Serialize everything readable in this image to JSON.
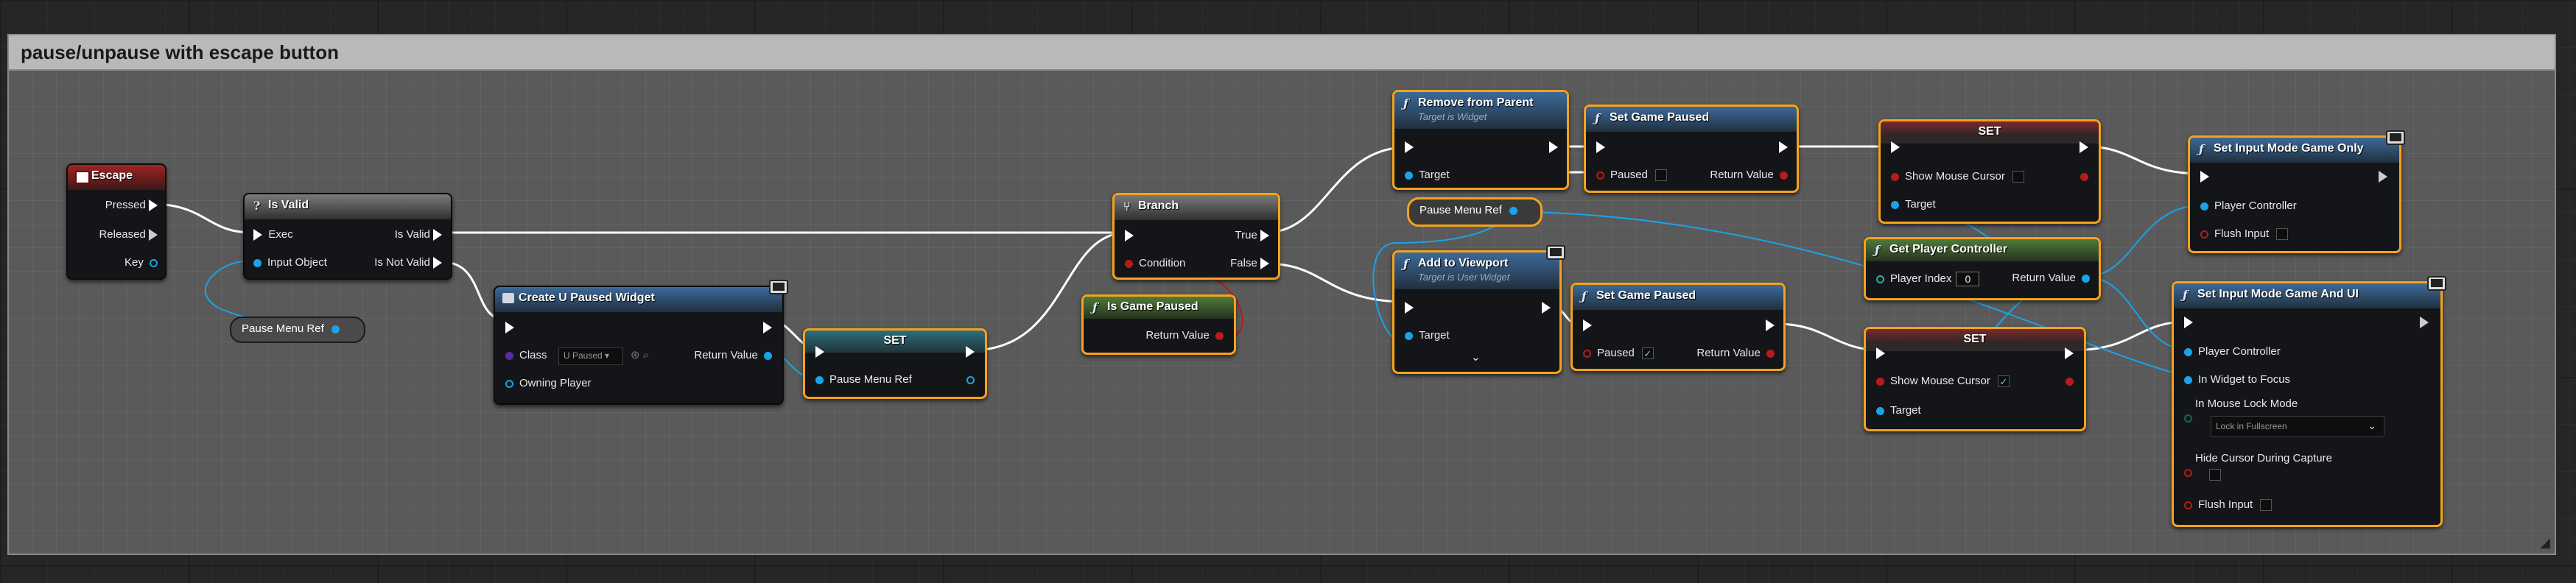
{
  "comment": {
    "title": "pause/unpause with escape button"
  },
  "nodes": {
    "escape": {
      "title": "Escape",
      "pins": {
        "pressed": "Pressed",
        "released": "Released",
        "key": "Key"
      }
    },
    "is_valid": {
      "title": "Is Valid",
      "pins": {
        "exec": "Exec",
        "input_object": "Input Object",
        "is_valid": "Is Valid",
        "is_not_valid": "Is Not Valid"
      }
    },
    "pause_menu_ref_get1": {
      "title": "Pause Menu Ref"
    },
    "create_widget": {
      "title": "Create U Paused Widget",
      "pins": {
        "class": "Class",
        "class_value": "U Paused",
        "owning_player": "Owning Player",
        "return_value": "Return Value"
      }
    },
    "set_ref": {
      "title": "SET",
      "pins": {
        "pause_menu_ref": "Pause Menu Ref"
      }
    },
    "branch": {
      "title": "Branch",
      "pins": {
        "condition": "Condition",
        "true": "True",
        "false": "False"
      }
    },
    "is_game_paused": {
      "title": "Is Game Paused",
      "pins": {
        "return_value": "Return Value"
      }
    },
    "remove_from_parent": {
      "title": "Remove from Parent",
      "subtitle": "Target is Widget",
      "pins": {
        "target": "Target"
      }
    },
    "pause_menu_ref_get2": {
      "title": "Pause Menu Ref"
    },
    "add_to_viewport": {
      "title": "Add to Viewport",
      "subtitle": "Target is User Widget",
      "pins": {
        "target": "Target"
      }
    },
    "set_game_paused_1": {
      "title": "Set Game Paused",
      "pins": {
        "paused": "Paused",
        "return_value": "Return Value"
      }
    },
    "set_game_paused_2": {
      "title": "Set Game Paused",
      "pins": {
        "paused": "Paused",
        "return_value": "Return Value"
      }
    },
    "set_cursor_1": {
      "title": "SET",
      "pins": {
        "show_mouse_cursor": "Show Mouse Cursor",
        "target": "Target"
      }
    },
    "get_player_controller": {
      "title": "Get Player Controller",
      "pins": {
        "player_index": "Player Index",
        "player_index_value": "0",
        "return_value": "Return Value"
      }
    },
    "set_cursor_2": {
      "title": "SET",
      "pins": {
        "show_mouse_cursor": "Show Mouse Cursor",
        "target": "Target"
      }
    },
    "set_input_game_only": {
      "title": "Set Input Mode Game Only",
      "pins": {
        "player_controller": "Player Controller",
        "flush_input": "Flush Input"
      }
    },
    "set_input_game_and_ui": {
      "title": "Set Input Mode Game And UI",
      "pins": {
        "player_controller": "Player Controller",
        "in_widget_to_focus": "In Widget to Focus",
        "in_mouse_lock_mode": "In Mouse Lock Mode",
        "lock_mode_value": "Lock in Fullscreen",
        "hide_cursor": "Hide Cursor During Capture",
        "flush_input": "Flush Input"
      }
    }
  },
  "colors": {
    "selection": "#f4a31b",
    "exec_wire": "#ffffff",
    "object_wire": "#1aa3e6",
    "bool_wire": "#b71b1b",
    "comment_header": "#b9b9b9",
    "comment_body": "#5a5a5a"
  },
  "checkbox_states": {
    "set_game_paused_1_paused": false,
    "set_game_paused_2_paused": true,
    "set_cursor_1_show": false,
    "set_cursor_2_show": true,
    "game_only_flush": false,
    "game_and_ui_hide_cursor": false,
    "game_and_ui_flush": false
  }
}
